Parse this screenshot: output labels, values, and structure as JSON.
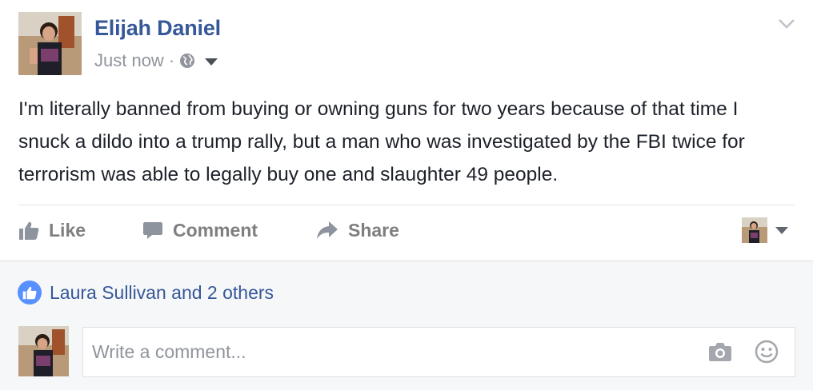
{
  "post": {
    "author": "Elijah Daniel",
    "timestamp": "Just now",
    "separator": "·",
    "privacy_icon": "globe-icon",
    "text": "I'm literally banned from buying or owning guns for two years because of that time I snuck a dildo into a trump rally, but a man who was investigated by the FBI twice for terrorism was able to legally buy one and slaughter 49 people."
  },
  "actions": {
    "like_label": "Like",
    "comment_label": "Comment",
    "share_label": "Share"
  },
  "reactions": {
    "summary": "Laura Sullivan and 2 others"
  },
  "comment": {
    "placeholder": "Write a comment..."
  },
  "colors": {
    "link_blue": "#365899",
    "action_gray": "#7f7f7f",
    "meta_gray": "#90949c",
    "like_badge_blue": "#5890ff",
    "lower_bg": "#f6f7f9"
  }
}
